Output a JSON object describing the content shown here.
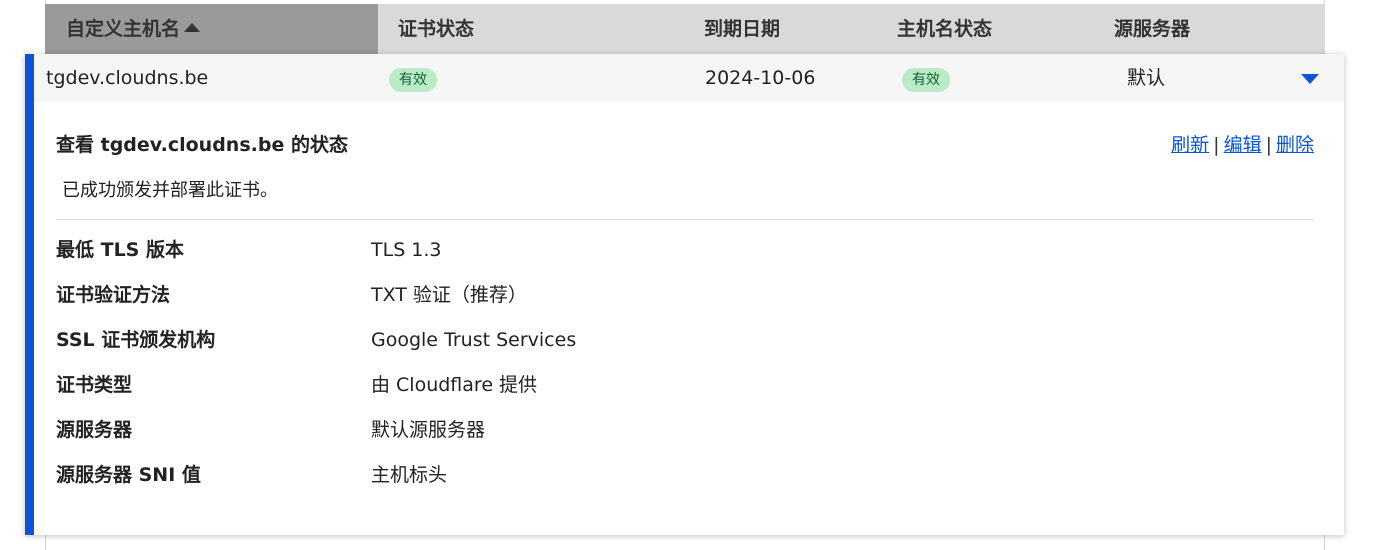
{
  "table": {
    "columns": [
      {
        "label": "自定义主机名",
        "sorted": "asc"
      },
      {
        "label": "证书状态"
      },
      {
        "label": "到期日期"
      },
      {
        "label": "主机名状态"
      },
      {
        "label": "源服务器"
      }
    ]
  },
  "row": {
    "hostname": "tgdev.cloudns.be",
    "cert_status": "有效",
    "expiry_date": "2024-10-06",
    "hostname_status": "有效",
    "origin": "默认"
  },
  "detail": {
    "title": "查看 tgdev.cloudns.be 的状态",
    "actions": {
      "refresh": "刷新",
      "edit": "编辑",
      "delete": "删除",
      "separator": "|"
    },
    "status_message": "已成功颁发并部署此证书。",
    "fields": [
      {
        "key": "最低 TLS 版本",
        "value": "TLS 1.3"
      },
      {
        "key": "证书验证方法",
        "value": "TXT 验证（推荐）"
      },
      {
        "key": "SSL 证书颁发机构",
        "value": "Google Trust Services"
      },
      {
        "key": "证书类型",
        "value": "由 Cloudflare 提供"
      },
      {
        "key": "源服务器",
        "value": "默认源服务器"
      },
      {
        "key": "源服务器 SNI 值",
        "value": "主机标头"
      }
    ]
  },
  "colors": {
    "accent": "#0a55d6",
    "badge_bg": "#b8ecc6",
    "badge_text": "#1c5e30",
    "header_bg": "#d9d9d9",
    "sorted_header_bg": "#9a9a9a"
  },
  "icons": {
    "sort": "caret-up-icon",
    "expand": "caret-down-icon"
  }
}
